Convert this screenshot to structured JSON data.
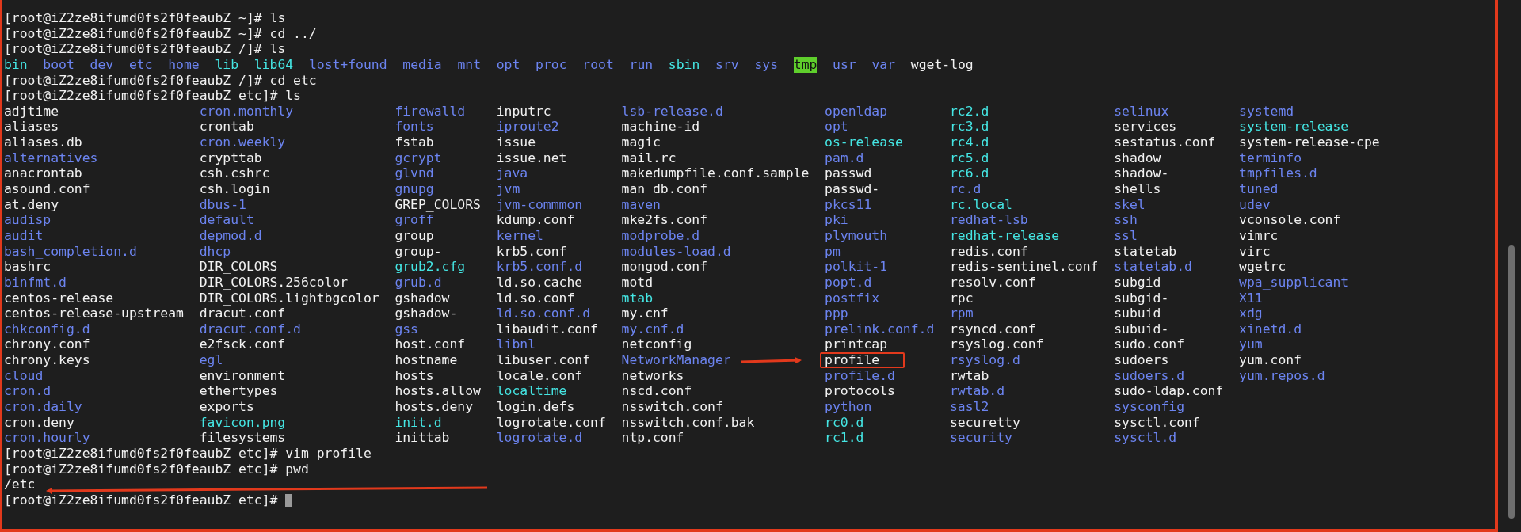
{
  "terminal": {
    "lines": [
      {
        "kind": "command",
        "text": "[root@iZ2ze8ifumd0fs2f0feaubZ ~]# ls"
      },
      {
        "kind": "command",
        "text": "[root@iZ2ze8ifumd0fs2f0feaubZ ~]# cd ../"
      },
      {
        "kind": "command",
        "text": "[root@iZ2ze8ifumd0fs2f0feaubZ /]# ls"
      },
      {
        "kind": "listing",
        "entries": [
          {
            "name": "bin",
            "kind": "link"
          },
          {
            "name": "boot",
            "kind": "dir"
          },
          {
            "name": "dev",
            "kind": "dir"
          },
          {
            "name": "etc",
            "kind": "dir"
          },
          {
            "name": "home",
            "kind": "dir"
          },
          {
            "name": "lib",
            "kind": "link"
          },
          {
            "name": "lib64",
            "kind": "link"
          },
          {
            "name": "lost+found",
            "kind": "dir"
          },
          {
            "name": "media",
            "kind": "dir"
          },
          {
            "name": "mnt",
            "kind": "dir"
          },
          {
            "name": "opt",
            "kind": "dir"
          },
          {
            "name": "proc",
            "kind": "dir"
          },
          {
            "name": "root",
            "kind": "dir"
          },
          {
            "name": "run",
            "kind": "dir"
          },
          {
            "name": "sbin",
            "kind": "link"
          },
          {
            "name": "srv",
            "kind": "dir"
          },
          {
            "name": "sys",
            "kind": "dir"
          },
          {
            "name": "tmp",
            "kind": "sticky"
          },
          {
            "name": "usr",
            "kind": "dir"
          },
          {
            "name": "var",
            "kind": "dir"
          },
          {
            "name": "wget-log",
            "kind": "file"
          }
        ]
      },
      {
        "kind": "command",
        "text": "[root@iZ2ze8ifumd0fs2f0feaubZ /]# cd etc"
      },
      {
        "kind": "command",
        "text": "[root@iZ2ze8ifumd0fs2f0feaubZ etc]# ls"
      },
      {
        "kind": "grid",
        "columns": [
          [
            {
              "name": "adjtime",
              "kind": "file"
            },
            {
              "name": "aliases",
              "kind": "file"
            },
            {
              "name": "aliases.db",
              "kind": "file"
            },
            {
              "name": "alternatives",
              "kind": "dir"
            },
            {
              "name": "anacrontab",
              "kind": "file"
            },
            {
              "name": "asound.conf",
              "kind": "file"
            },
            {
              "name": "at.deny",
              "kind": "file"
            },
            {
              "name": "audisp",
              "kind": "dir"
            },
            {
              "name": "audit",
              "kind": "dir"
            },
            {
              "name": "bash_completion.d",
              "kind": "dir"
            },
            {
              "name": "bashrc",
              "kind": "file"
            },
            {
              "name": "binfmt.d",
              "kind": "dir"
            },
            {
              "name": "centos-release",
              "kind": "file"
            },
            {
              "name": "centos-release-upstream",
              "kind": "file"
            },
            {
              "name": "chkconfig.d",
              "kind": "dir"
            },
            {
              "name": "chrony.conf",
              "kind": "file"
            },
            {
              "name": "chrony.keys",
              "kind": "file"
            },
            {
              "name": "cloud",
              "kind": "dir"
            },
            {
              "name": "cron.d",
              "kind": "dir"
            },
            {
              "name": "cron.daily",
              "kind": "dir"
            },
            {
              "name": "cron.deny",
              "kind": "file"
            },
            {
              "name": "cron.hourly",
              "kind": "dir"
            }
          ],
          [
            {
              "name": "cron.monthly",
              "kind": "dir"
            },
            {
              "name": "crontab",
              "kind": "file"
            },
            {
              "name": "cron.weekly",
              "kind": "dir"
            },
            {
              "name": "crypttab",
              "kind": "file"
            },
            {
              "name": "csh.cshrc",
              "kind": "file"
            },
            {
              "name": "csh.login",
              "kind": "file"
            },
            {
              "name": "dbus-1",
              "kind": "dir"
            },
            {
              "name": "default",
              "kind": "dir"
            },
            {
              "name": "depmod.d",
              "kind": "dir"
            },
            {
              "name": "dhcp",
              "kind": "dir"
            },
            {
              "name": "DIR_COLORS",
              "kind": "file"
            },
            {
              "name": "DIR_COLORS.256color",
              "kind": "file"
            },
            {
              "name": "DIR_COLORS.lightbgcolor",
              "kind": "file"
            },
            {
              "name": "dracut.conf",
              "kind": "file"
            },
            {
              "name": "dracut.conf.d",
              "kind": "dir"
            },
            {
              "name": "e2fsck.conf",
              "kind": "file"
            },
            {
              "name": "egl",
              "kind": "dir"
            },
            {
              "name": "environment",
              "kind": "file"
            },
            {
              "name": "ethertypes",
              "kind": "file"
            },
            {
              "name": "exports",
              "kind": "file"
            },
            {
              "name": "favicon.png",
              "kind": "link"
            },
            {
              "name": "filesystems",
              "kind": "file"
            }
          ],
          [
            {
              "name": "firewalld",
              "kind": "dir"
            },
            {
              "name": "fonts",
              "kind": "dir"
            },
            {
              "name": "fstab",
              "kind": "file"
            },
            {
              "name": "gcrypt",
              "kind": "dir"
            },
            {
              "name": "glvnd",
              "kind": "dir"
            },
            {
              "name": "gnupg",
              "kind": "dir"
            },
            {
              "name": "GREP_COLORS",
              "kind": "file"
            },
            {
              "name": "groff",
              "kind": "dir"
            },
            {
              "name": "group",
              "kind": "file"
            },
            {
              "name": "group-",
              "kind": "file"
            },
            {
              "name": "grub2.cfg",
              "kind": "link"
            },
            {
              "name": "grub.d",
              "kind": "dir"
            },
            {
              "name": "gshadow",
              "kind": "file"
            },
            {
              "name": "gshadow-",
              "kind": "file"
            },
            {
              "name": "gss",
              "kind": "dir"
            },
            {
              "name": "host.conf",
              "kind": "file"
            },
            {
              "name": "hostname",
              "kind": "file"
            },
            {
              "name": "hosts",
              "kind": "file"
            },
            {
              "name": "hosts.allow",
              "kind": "file"
            },
            {
              "name": "hosts.deny",
              "kind": "file"
            },
            {
              "name": "init.d",
              "kind": "link"
            },
            {
              "name": "inittab",
              "kind": "file"
            }
          ],
          [
            {
              "name": "inputrc",
              "kind": "file"
            },
            {
              "name": "iproute2",
              "kind": "dir"
            },
            {
              "name": "issue",
              "kind": "file"
            },
            {
              "name": "issue.net",
              "kind": "file"
            },
            {
              "name": "java",
              "kind": "dir"
            },
            {
              "name": "jvm",
              "kind": "dir"
            },
            {
              "name": "jvm-commmon",
              "kind": "dir"
            },
            {
              "name": "kdump.conf",
              "kind": "file"
            },
            {
              "name": "kernel",
              "kind": "dir"
            },
            {
              "name": "krb5.conf",
              "kind": "file"
            },
            {
              "name": "krb5.conf.d",
              "kind": "dir"
            },
            {
              "name": "ld.so.cache",
              "kind": "file"
            },
            {
              "name": "ld.so.conf",
              "kind": "file"
            },
            {
              "name": "ld.so.conf.d",
              "kind": "dir"
            },
            {
              "name": "libaudit.conf",
              "kind": "file"
            },
            {
              "name": "libnl",
              "kind": "dir"
            },
            {
              "name": "libuser.conf",
              "kind": "file"
            },
            {
              "name": "locale.conf",
              "kind": "file"
            },
            {
              "name": "localtime",
              "kind": "link"
            },
            {
              "name": "login.defs",
              "kind": "file"
            },
            {
              "name": "logrotate.conf",
              "kind": "file"
            },
            {
              "name": "logrotate.d",
              "kind": "dir"
            }
          ],
          [
            {
              "name": "lsb-release.d",
              "kind": "dir"
            },
            {
              "name": "machine-id",
              "kind": "file"
            },
            {
              "name": "magic",
              "kind": "file"
            },
            {
              "name": "mail.rc",
              "kind": "file"
            },
            {
              "name": "makedumpfile.conf.sample",
              "kind": "file"
            },
            {
              "name": "man_db.conf",
              "kind": "file"
            },
            {
              "name": "maven",
              "kind": "dir"
            },
            {
              "name": "mke2fs.conf",
              "kind": "file"
            },
            {
              "name": "modprobe.d",
              "kind": "dir"
            },
            {
              "name": "modules-load.d",
              "kind": "dir"
            },
            {
              "name": "mongod.conf",
              "kind": "file"
            },
            {
              "name": "motd",
              "kind": "file"
            },
            {
              "name": "mtab",
              "kind": "link"
            },
            {
              "name": "my.cnf",
              "kind": "file"
            },
            {
              "name": "my.cnf.d",
              "kind": "dir"
            },
            {
              "name": "netconfig",
              "kind": "file"
            },
            {
              "name": "NetworkManager",
              "kind": "dir"
            },
            {
              "name": "networks",
              "kind": "file"
            },
            {
              "name": "nscd.conf",
              "kind": "file"
            },
            {
              "name": "nsswitch.conf",
              "kind": "file"
            },
            {
              "name": "nsswitch.conf.bak",
              "kind": "file"
            },
            {
              "name": "ntp.conf",
              "kind": "file"
            }
          ],
          [
            {
              "name": "openldap",
              "kind": "dir"
            },
            {
              "name": "opt",
              "kind": "dir"
            },
            {
              "name": "os-release",
              "kind": "link"
            },
            {
              "name": "pam.d",
              "kind": "dir"
            },
            {
              "name": "passwd",
              "kind": "file"
            },
            {
              "name": "passwd-",
              "kind": "file"
            },
            {
              "name": "pkcs11",
              "kind": "dir"
            },
            {
              "name": "pki",
              "kind": "dir"
            },
            {
              "name": "plymouth",
              "kind": "dir"
            },
            {
              "name": "pm",
              "kind": "dir"
            },
            {
              "name": "polkit-1",
              "kind": "dir"
            },
            {
              "name": "popt.d",
              "kind": "dir"
            },
            {
              "name": "postfix",
              "kind": "dir"
            },
            {
              "name": "ppp",
              "kind": "dir"
            },
            {
              "name": "prelink.conf.d",
              "kind": "dir"
            },
            {
              "name": "printcap",
              "kind": "file"
            },
            {
              "name": "profile",
              "kind": "file",
              "boxed": true
            },
            {
              "name": "profile.d",
              "kind": "dir"
            },
            {
              "name": "protocols",
              "kind": "file"
            },
            {
              "name": "python",
              "kind": "dir"
            },
            {
              "name": "rc0.d",
              "kind": "link"
            },
            {
              "name": "rc1.d",
              "kind": "link"
            }
          ],
          [
            {
              "name": "rc2.d",
              "kind": "link"
            },
            {
              "name": "rc3.d",
              "kind": "link"
            },
            {
              "name": "rc4.d",
              "kind": "link"
            },
            {
              "name": "rc5.d",
              "kind": "link"
            },
            {
              "name": "rc6.d",
              "kind": "link"
            },
            {
              "name": "rc.d",
              "kind": "dir"
            },
            {
              "name": "rc.local",
              "kind": "link"
            },
            {
              "name": "redhat-lsb",
              "kind": "dir"
            },
            {
              "name": "redhat-release",
              "kind": "link"
            },
            {
              "name": "redis.conf",
              "kind": "file"
            },
            {
              "name": "redis-sentinel.conf",
              "kind": "file"
            },
            {
              "name": "resolv.conf",
              "kind": "file"
            },
            {
              "name": "rpc",
              "kind": "file"
            },
            {
              "name": "rpm",
              "kind": "dir"
            },
            {
              "name": "rsyncd.conf",
              "kind": "file"
            },
            {
              "name": "rsyslog.conf",
              "kind": "file"
            },
            {
              "name": "rsyslog.d",
              "kind": "dir"
            },
            {
              "name": "rwtab",
              "kind": "file"
            },
            {
              "name": "rwtab.d",
              "kind": "dir"
            },
            {
              "name": "sasl2",
              "kind": "dir"
            },
            {
              "name": "securetty",
              "kind": "file"
            },
            {
              "name": "security",
              "kind": "dir"
            }
          ],
          [
            {
              "name": "selinux",
              "kind": "dir"
            },
            {
              "name": "services",
              "kind": "file"
            },
            {
              "name": "sestatus.conf",
              "kind": "file"
            },
            {
              "name": "shadow",
              "kind": "file"
            },
            {
              "name": "shadow-",
              "kind": "file"
            },
            {
              "name": "shells",
              "kind": "file"
            },
            {
              "name": "skel",
              "kind": "dir"
            },
            {
              "name": "ssh",
              "kind": "dir"
            },
            {
              "name": "ssl",
              "kind": "dir"
            },
            {
              "name": "statetab",
              "kind": "file"
            },
            {
              "name": "statetab.d",
              "kind": "dir"
            },
            {
              "name": "subgid",
              "kind": "file"
            },
            {
              "name": "subgid-",
              "kind": "file"
            },
            {
              "name": "subuid",
              "kind": "file"
            },
            {
              "name": "subuid-",
              "kind": "file"
            },
            {
              "name": "sudo.conf",
              "kind": "file"
            },
            {
              "name": "sudoers",
              "kind": "file"
            },
            {
              "name": "sudoers.d",
              "kind": "dir"
            },
            {
              "name": "sudo-ldap.conf",
              "kind": "file"
            },
            {
              "name": "sysconfig",
              "kind": "dir"
            },
            {
              "name": "sysctl.conf",
              "kind": "file"
            },
            {
              "name": "sysctl.d",
              "kind": "dir"
            }
          ],
          [
            {
              "name": "systemd",
              "kind": "dir"
            },
            {
              "name": "system-release",
              "kind": "link"
            },
            {
              "name": "system-release-cpe",
              "kind": "file"
            },
            {
              "name": "terminfo",
              "kind": "dir"
            },
            {
              "name": "tmpfiles.d",
              "kind": "dir"
            },
            {
              "name": "tuned",
              "kind": "dir"
            },
            {
              "name": "udev",
              "kind": "dir"
            },
            {
              "name": "vconsole.conf",
              "kind": "file"
            },
            {
              "name": "vimrc",
              "kind": "file"
            },
            {
              "name": "virc",
              "kind": "file"
            },
            {
              "name": "wgetrc",
              "kind": "file"
            },
            {
              "name": "wpa_supplicant",
              "kind": "dir"
            },
            {
              "name": "X11",
              "kind": "dir"
            },
            {
              "name": "xdg",
              "kind": "dir"
            },
            {
              "name": "xinetd.d",
              "kind": "dir"
            },
            {
              "name": "yum",
              "kind": "dir"
            },
            {
              "name": "yum.conf",
              "kind": "file"
            },
            {
              "name": "yum.repos.d",
              "kind": "dir"
            }
          ]
        ]
      },
      {
        "kind": "command",
        "text": "[root@iZ2ze8ifumd0fs2f0feaubZ etc]# vim profile"
      },
      {
        "kind": "command",
        "text": "[root@iZ2ze8ifumd0fs2f0feaubZ etc]# pwd"
      },
      {
        "kind": "output",
        "text": "/etc"
      },
      {
        "kind": "command",
        "text": "[root@iZ2ze8ifumd0fs2f0feaubZ etc]#",
        "cursor": true
      }
    ]
  },
  "annotations": [
    {
      "kind": "frame"
    },
    {
      "kind": "arrow"
    },
    {
      "kind": "arrow"
    }
  ]
}
